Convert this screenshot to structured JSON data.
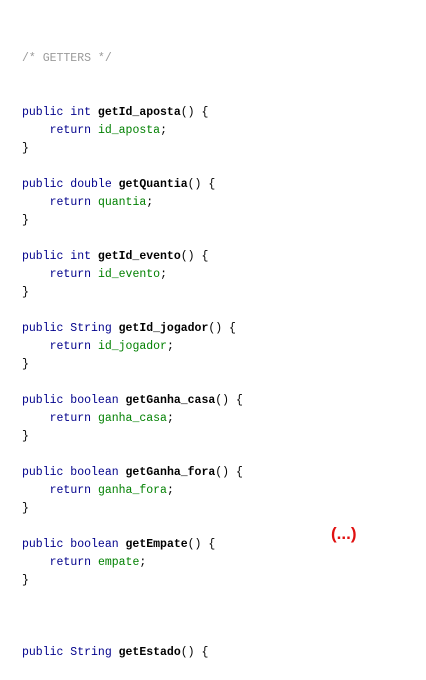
{
  "code": {
    "comment": "/* GETTERS */",
    "indent": "    ",
    "return_keyword": "return",
    "open_suffix": "() {",
    "close_brace": "}",
    "semicolon": ";",
    "getters": [
      {
        "signature": "public int ",
        "name": "getId_aposta",
        "field": "id_aposta"
      },
      {
        "signature": "public double ",
        "name": "getQuantia",
        "field": "quantia"
      },
      {
        "signature": "public int ",
        "name": "getId_evento",
        "field": "id_evento"
      },
      {
        "signature": "public String ",
        "name": "getId_jogador",
        "field": "id_jogador"
      },
      {
        "signature": "public boolean ",
        "name": "getGanha_casa",
        "field": "ganha_casa"
      },
      {
        "signature": "public boolean ",
        "name": "getGanha_fora",
        "field": "ganha_fora"
      },
      {
        "signature": "public boolean ",
        "name": "getEmpate",
        "field": "empate"
      }
    ],
    "last_method": {
      "signature": "public String ",
      "name": "getEstado"
    }
  },
  "annotation": {
    "ellipsis": "(...)"
  },
  "colors": {
    "keyword": "#00008b",
    "method": "#000000",
    "field": "#008000",
    "comment": "#9a9a9a",
    "annotation": "#e01010"
  }
}
